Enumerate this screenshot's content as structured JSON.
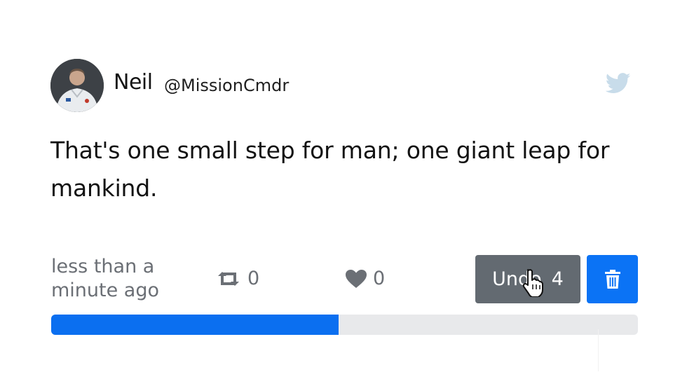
{
  "tweet": {
    "author_name": "Neil",
    "author_handle": "@MissionCmdr",
    "text": "That's one small step for man; one giant leap for mankind.",
    "timestamp": "less than a minute ago",
    "retweet_count": "0",
    "like_count": "0"
  },
  "actions": {
    "undo_label": "Undo",
    "undo_countdown": "4",
    "delete_icon": "trash-icon"
  },
  "progress": {
    "fraction": 0.49
  },
  "icons": {
    "brand": "twitter-bird-icon",
    "retweet": "retweet-icon",
    "like": "heart-icon",
    "cursor": "hand-pointer-cursor"
  },
  "colors": {
    "undo_bg": "#636a71",
    "delete_bg": "#0b73f5",
    "progress_fill": "#0b6ff0",
    "progress_track": "#e8e9eb",
    "muted_text": "#6b6f75",
    "bird": "#c8dcea"
  }
}
